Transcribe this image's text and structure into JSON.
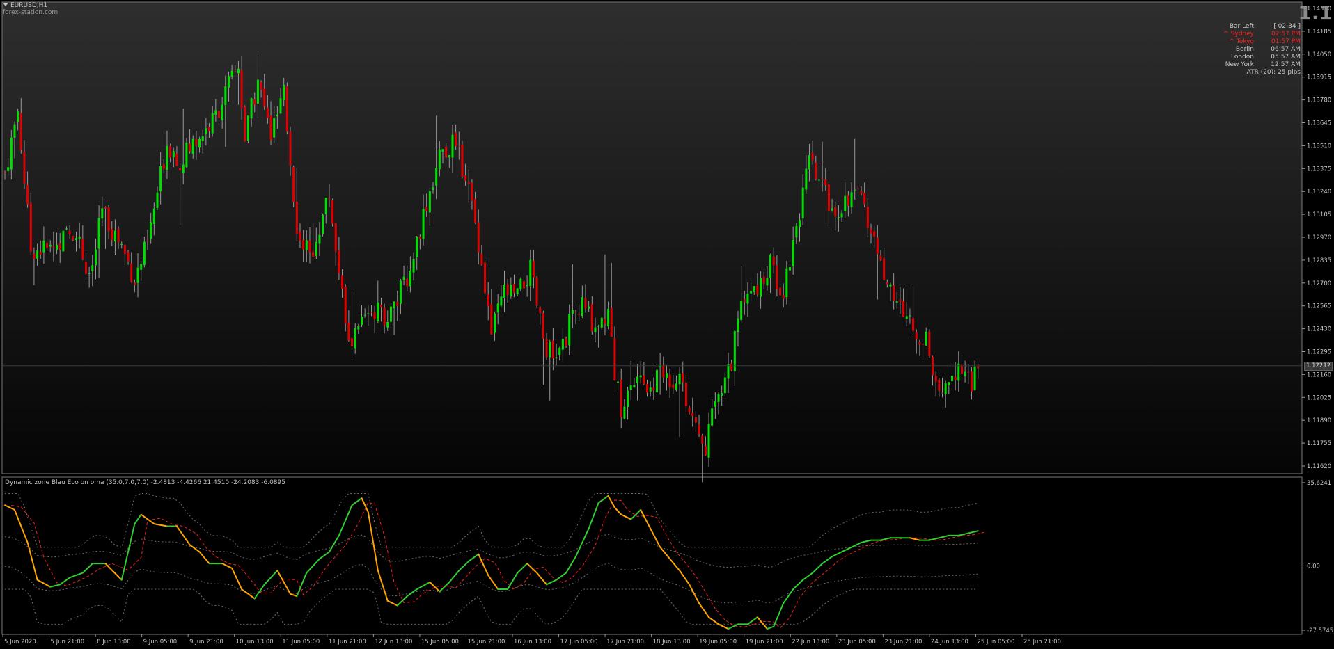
{
  "header": {
    "symbol": "EURUSD,H1",
    "watermark": "forex-station.com",
    "big_value": "1.1"
  },
  "sessions": [
    {
      "label": "Bar Left",
      "value": "[ 02:34 ]",
      "color": "#c8c8c8"
    },
    {
      "label": "^ Sydney",
      "value": "02:57 PM",
      "color": "#ff2020"
    },
    {
      "label": "^ Tokyo",
      "value": "01:57 PM",
      "color": "#ff2020"
    },
    {
      "label": "Berlin",
      "value": "06:57 AM",
      "color": "#c8c8c8"
    },
    {
      "label": "London",
      "value": "05:57 AM",
      "color": "#c8c8c8"
    },
    {
      "label": "New York",
      "value": "12:57 AM",
      "color": "#c8c8c8"
    }
  ],
  "atr_text": "ATR (20): 25 pips",
  "current_price": "1.12212",
  "indicator_label": "Dynamic zone Blau Eco on oma (35.0,7.0,7.0) -2.4813 -4.4266 21.4510 -24.2083 -6.0895",
  "colors": {
    "bull": "#00e000",
    "bear": "#e00000",
    "line_up": "#32cd32",
    "line_down": "#ffa500",
    "signal": "#ff2020",
    "zones": "#707070"
  },
  "chart_data": [
    {
      "type": "candlestick",
      "title": "EURUSD,H1",
      "y_ticks": [
        "1.14320",
        "1.14185",
        "1.14050",
        "1.13915",
        "1.13780",
        "1.13645",
        "1.13510",
        "1.13375",
        "1.13240",
        "1.13105",
        "1.12970",
        "1.12835",
        "1.12700",
        "1.12565",
        "1.12430",
        "1.12295",
        "1.12160",
        "1.12025",
        "1.11890",
        "1.11755",
        "1.11620"
      ],
      "ylim": [
        1.1162,
        1.1432
      ],
      "x_ticks": [
        "5 Jun 2020",
        "5 Jun 21:00",
        "8 Jun 13:00",
        "9 Jun 05:00",
        "9 Jun 21:00",
        "10 Jun 13:00",
        "11 Jun 05:00",
        "11 Jun 21:00",
        "12 Jun 13:00",
        "15 Jun 05:00",
        "15 Jun 21:00",
        "16 Jun 13:00",
        "17 Jun 05:00",
        "17 Jun 21:00",
        "18 Jun 13:00",
        "19 Jun 05:00",
        "19 Jun 21:00",
        "22 Jun 13:00",
        "23 Jun 05:00",
        "23 Jun 21:00",
        "24 Jun 13:00",
        "25 Jun 05:00",
        "25 Jun 21:00"
      ],
      "close_path": [
        [
          0,
          1.1335
        ],
        [
          4,
          1.1372
        ],
        [
          8,
          1.129
        ],
        [
          14,
          1.129
        ],
        [
          22,
          1.1302
        ],
        [
          26,
          1.127
        ],
        [
          30,
          1.1312
        ],
        [
          36,
          1.1292
        ],
        [
          40,
          1.1272
        ],
        [
          44,
          1.1293
        ],
        [
          50,
          1.1353
        ],
        [
          54,
          1.1342
        ],
        [
          60,
          1.1357
        ],
        [
          64,
          1.1365
        ],
        [
          68,
          1.1382
        ],
        [
          72,
          1.1398
        ],
        [
          74,
          1.1355
        ],
        [
          78,
          1.1389
        ],
        [
          82,
          1.1357
        ],
        [
          86,
          1.138
        ],
        [
          90,
          1.1305
        ],
        [
          94,
          1.1285
        ],
        [
          100,
          1.1322
        ],
        [
          106,
          1.1232
        ],
        [
          112,
          1.1255
        ],
        [
          118,
          1.125
        ],
        [
          124,
          1.1272
        ],
        [
          130,
          1.1318
        ],
        [
          134,
          1.1345
        ],
        [
          138,
          1.1352
        ],
        [
          142,
          1.1335
        ],
        [
          146,
          1.1295
        ],
        [
          150,
          1.124
        ],
        [
          154,
          1.1265
        ],
        [
          158,
          1.1262
        ],
        [
          162,
          1.1277
        ],
        [
          166,
          1.1237
        ],
        [
          170,
          1.1222
        ],
        [
          174,
          1.1245
        ],
        [
          178,
          1.1257
        ],
        [
          182,
          1.1245
        ],
        [
          186,
          1.1252
        ],
        [
          188,
          1.1217
        ],
        [
          190,
          1.1195
        ],
        [
          194,
          1.1212
        ],
        [
          198,
          1.1207
        ],
        [
          202,
          1.1217
        ],
        [
          206,
          1.1212
        ],
        [
          208,
          1.122
        ],
        [
          212,
          1.1185
        ],
        [
          216,
          1.1175
        ],
        [
          220,
          1.1205
        ],
        [
          224,
          1.1225
        ],
        [
          228,
          1.1265
        ],
        [
          232,
          1.1265
        ],
        [
          236,
          1.128
        ],
        [
          240,
          1.1265
        ],
        [
          244,
          1.1305
        ],
        [
          248,
          1.134
        ],
        [
          252,
          1.1325
        ],
        [
          256,
          1.1312
        ],
        [
          260,
          1.1322
        ],
        [
          264,
          1.1318
        ],
        [
          268,
          1.1295
        ],
        [
          272,
          1.127
        ],
        [
          276,
          1.1255
        ],
        [
          280,
          1.1245
        ],
        [
          284,
          1.1235
        ],
        [
          288,
          1.12
        ],
        [
          290,
          1.1212
        ],
        [
          294,
          1.1222
        ],
        [
          298,
          1.1212
        ],
        [
          300,
          1.1216
        ]
      ],
      "current_price": 1.12212
    },
    {
      "type": "line",
      "title": "Dynamic zone Blau Eco on oma (35.0,7.0,7.0)",
      "y_ticks": [
        "35.6241",
        "0.00",
        "-27.5745"
      ],
      "ylim": [
        -27.5745,
        35.6241
      ],
      "series": [
        {
          "name": "main",
          "x": [
            0,
            3,
            7,
            10,
            14,
            17,
            20,
            24,
            27,
            31,
            36,
            40,
            42,
            46,
            50,
            53,
            57,
            60,
            63,
            67,
            70,
            73,
            77,
            80,
            84,
            88,
            90,
            93,
            97,
            100,
            103,
            107,
            110,
            112,
            115,
            118,
            121,
            124,
            127,
            131,
            134,
            137,
            140,
            143,
            146,
            149,
            152,
            155,
            158,
            161,
            164,
            167,
            170,
            173,
            176,
            180,
            183,
            186,
            188,
            190,
            193,
            196,
            199,
            202,
            205,
            208,
            211,
            214,
            217,
            220,
            223,
            226,
            229,
            232,
            235,
            237,
            240,
            243,
            246,
            249,
            252,
            255,
            258,
            261,
            264,
            267,
            270,
            273,
            276,
            279,
            282,
            285,
            288,
            291,
            294,
            297,
            300
          ],
          "y": [
            26,
            24,
            10,
            -6,
            -9,
            -8,
            -5,
            -3,
            1,
            1,
            -6,
            18,
            22,
            18,
            17,
            17,
            9,
            6,
            1,
            1,
            -1,
            -10,
            -14,
            -8,
            -2,
            -12,
            -13,
            -3,
            3,
            6,
            13,
            26,
            29,
            23,
            -2,
            -15,
            -17,
            -13,
            -10,
            -7,
            -11,
            -7,
            -2,
            2,
            5,
            -4,
            -10,
            -10,
            -3,
            1,
            -3,
            -8,
            -6,
            -3,
            4,
            16,
            27,
            30,
            25,
            22,
            20,
            24,
            16,
            8,
            3,
            -2,
            -8,
            -16,
            -22,
            -25,
            -27,
            -25,
            -25,
            -22,
            -27,
            -26,
            -16,
            -10,
            -6,
            -3,
            1,
            4,
            6,
            8,
            10,
            11,
            11,
            12,
            12,
            12,
            11,
            11,
            12,
            13,
            13,
            14,
            15
          ],
          "down_segments": "mixed"
        }
      ]
    }
  ]
}
